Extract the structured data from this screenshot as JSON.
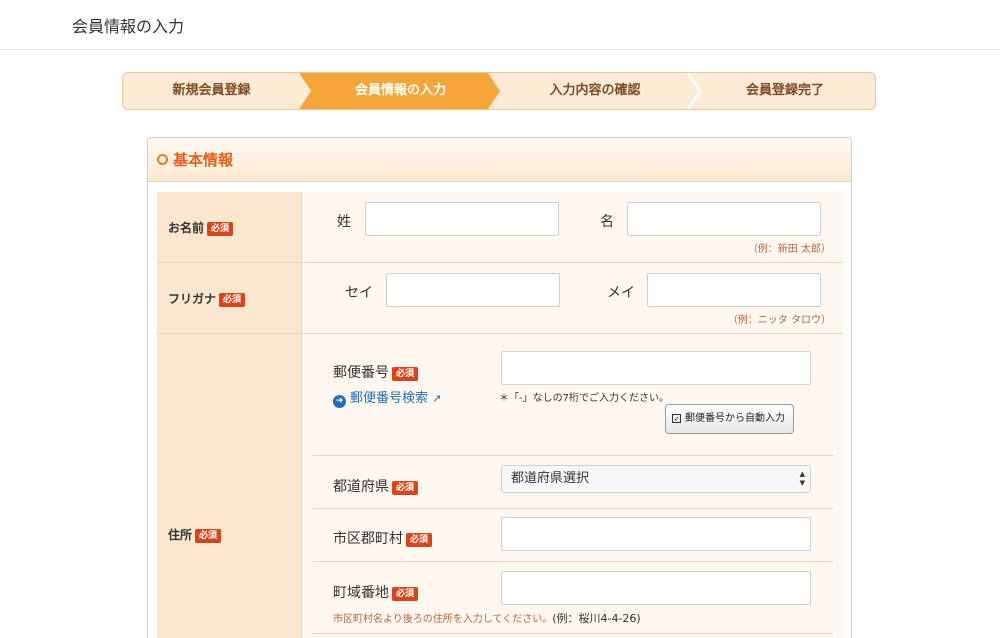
{
  "header": {
    "title": "会員情報の入力"
  },
  "steps": [
    {
      "label": "新規会員登録",
      "active": false
    },
    {
      "label": "会員情報の入力",
      "active": true
    },
    {
      "label": "入力内容の確認",
      "active": false
    },
    {
      "label": "会員登録完了",
      "active": false
    }
  ],
  "colors": {
    "accent": "#f6a53a",
    "step_bg": "#fdebd6",
    "required": "#d9441b",
    "link": "#1f6fb8"
  },
  "section": {
    "title": "基本情報"
  },
  "required_badge": "必須",
  "name_row": {
    "label": "お名前",
    "last_label": "姓",
    "first_label": "名",
    "last_value": "",
    "first_value": "",
    "hint": "（例：新田 太郎）"
  },
  "kana_row": {
    "label": "フリガナ",
    "last_label": "セイ",
    "first_label": "メイ",
    "last_value": "",
    "first_value": "",
    "hint": "（例：ニッタ タロウ）"
  },
  "address_row": {
    "label": "住所",
    "postal": {
      "label": "郵便番号",
      "value": "",
      "search_link": "郵便番号検索",
      "note": "＊「-」なしの7桁でご入力ください。",
      "auto_button": "郵便番号から自動入力"
    },
    "prefecture": {
      "label": "都道府県",
      "selected": "都道府県選択"
    },
    "city": {
      "label": "市区郡町村",
      "value": ""
    },
    "street": {
      "label": "町域番地",
      "value": "",
      "hint": "市区町村名より後ろの住所を入力してください。",
      "example": "(例：桜川4-4-26)"
    }
  }
}
